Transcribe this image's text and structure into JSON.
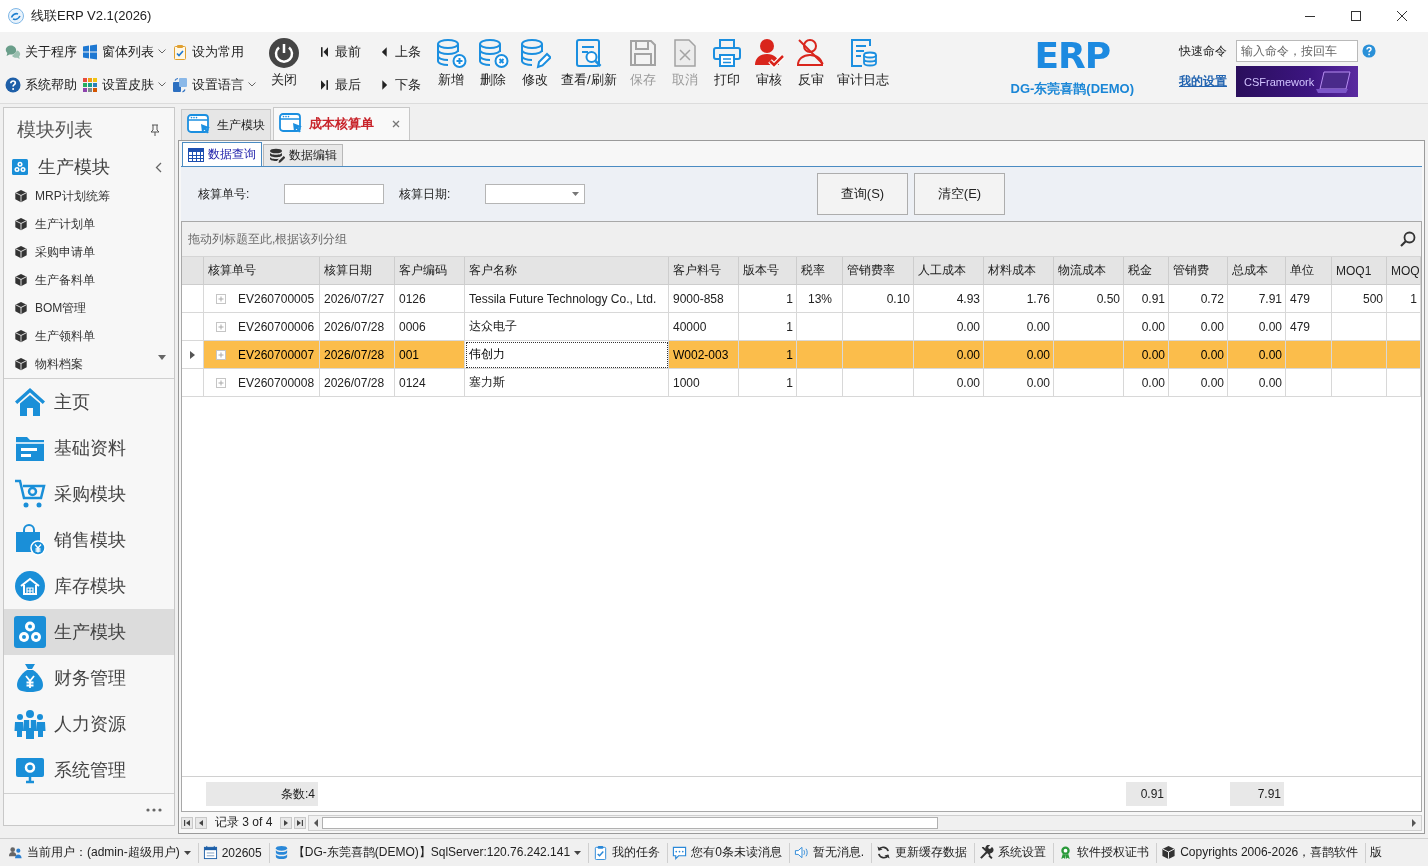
{
  "window": {
    "title": "线联ERP V2.1(2026)"
  },
  "toolbar": {
    "quick_items": [
      {
        "label": "关于程序",
        "dropdown": false
      },
      {
        "label": "窗体列表",
        "dropdown": true
      },
      {
        "label": "设为常用",
        "dropdown": false
      },
      {
        "label": "系统帮助",
        "dropdown": false
      },
      {
        "label": "设置皮肤",
        "dropdown": true
      },
      {
        "label": "设置语言",
        "dropdown": true
      }
    ],
    "close_button": {
      "label": "关闭"
    },
    "nav_buttons": [
      {
        "label": "最前"
      },
      {
        "label": "上条"
      },
      {
        "label": "最后"
      },
      {
        "label": "下条"
      }
    ],
    "buttons": [
      {
        "label": "新增",
        "disabled": false
      },
      {
        "label": "删除",
        "disabled": false
      },
      {
        "label": "修改",
        "disabled": false
      },
      {
        "label": "查看/刷新",
        "disabled": false
      },
      {
        "label": "保存",
        "disabled": true
      },
      {
        "label": "取消",
        "disabled": true
      },
      {
        "label": "打印",
        "disabled": false
      },
      {
        "label": "审核",
        "disabled": false
      },
      {
        "label": "反审",
        "disabled": false
      },
      {
        "label": "审计日志",
        "disabled": false
      }
    ],
    "brand": {
      "logo": "ERP",
      "company": "DG-东莞喜鹊(DEMO)"
    },
    "quick_command": {
      "label": "快速命令",
      "placeholder": "输入命令，按回车"
    },
    "settings_link": "我的设置",
    "banner": {
      "text": "CSFramework"
    }
  },
  "sidebar": {
    "title": "模块列表",
    "group": {
      "label": "生产模块"
    },
    "items": [
      "MRP计划统筹",
      "生产计划单",
      "采购申请单",
      "生产备料单",
      "BOM管理",
      "生产领料单",
      "物料档案"
    ],
    "modules": [
      {
        "label": "主页",
        "selected": false
      },
      {
        "label": "基础资料",
        "selected": false
      },
      {
        "label": "采购模块",
        "selected": false
      },
      {
        "label": "销售模块",
        "selected": false
      },
      {
        "label": "库存模块",
        "selected": false
      },
      {
        "label": "生产模块",
        "selected": true
      },
      {
        "label": "财务管理",
        "selected": false
      },
      {
        "label": "人力资源",
        "selected": false
      },
      {
        "label": "系统管理",
        "selected": false
      }
    ]
  },
  "tabs": [
    {
      "label": "生产模块",
      "selected": false,
      "closable": false
    },
    {
      "label": "成本核算单",
      "selected": true,
      "closable": true
    }
  ],
  "view_tabs": [
    {
      "label": "数据查询",
      "selected": true
    },
    {
      "label": "数据编辑",
      "selected": false
    }
  ],
  "query": {
    "fields": [
      {
        "label": "核算单号:",
        "kind": "text"
      },
      {
        "label": "核算日期:",
        "kind": "date"
      }
    ],
    "buttons": [
      "查询(S)",
      "清空(E)"
    ]
  },
  "grid": {
    "group_hint": "拖动列标题至此,根据该列分组",
    "columns": [
      {
        "label": "核算单号",
        "kind": "text"
      },
      {
        "label": "核算日期",
        "kind": "text"
      },
      {
        "label": "客户编码",
        "kind": "text"
      },
      {
        "label": "客户名称",
        "kind": "text"
      },
      {
        "label": "客户料号",
        "kind": "text"
      },
      {
        "label": "版本号",
        "kind": "number"
      },
      {
        "label": "税率",
        "kind": "percent"
      },
      {
        "label": "管销费率",
        "kind": "number"
      },
      {
        "label": "人工成本",
        "kind": "number"
      },
      {
        "label": "材料成本",
        "kind": "number"
      },
      {
        "label": "物流成本",
        "kind": "number"
      },
      {
        "label": "税金",
        "kind": "number"
      },
      {
        "label": "管销费",
        "kind": "number"
      },
      {
        "label": "总成本",
        "kind": "number"
      },
      {
        "label": "单位",
        "kind": "text"
      },
      {
        "label": "MOQ1",
        "kind": "number"
      },
      {
        "label": "MOQ",
        "kind": "number"
      }
    ],
    "rows": [
      {
        "selected": false,
        "order_no": "EV260700005",
        "date": "2026/07/27",
        "customer_code": "0126",
        "customer_name": "Tessila Future Technology Co., Ltd.",
        "part_no": "9000-858",
        "version": "1",
        "tax_rate": "13%",
        "fee_rate": "0.10",
        "labor_cost": "4.93",
        "material_cost": "1.76",
        "logistics_cost": "0.50",
        "tax": "0.91",
        "fee": "0.72",
        "total_cost": "7.91",
        "unit": "479",
        "moq1": "500",
        "column_17": "1"
      },
      {
        "selected": false,
        "order_no": "EV260700006",
        "date": "2026/07/28",
        "customer_code": "0006",
        "customer_name": "达众电子",
        "part_no": "40000",
        "version": "1",
        "labor_cost": "0.00",
        "material_cost": "0.00",
        "tax": "0.00",
        "fee": "0.00",
        "total_cost": "0.00",
        "unit": "479"
      },
      {
        "selected": true,
        "order_no": "EV260700007",
        "date": "2026/07/28",
        "customer_code": "001",
        "customer_name": {
          "text": "伟创力",
          "focused": true
        },
        "part_no": "W002-003",
        "version": "1",
        "labor_cost": "0.00",
        "material_cost": "0.00",
        "tax": "0.00",
        "fee": "0.00",
        "total_cost": "0.00"
      },
      {
        "selected": false,
        "order_no": "EV260700008",
        "date": "2026/07/28",
        "customer_code": "0124",
        "customer_name": "塞力斯",
        "part_no": "1000",
        "version": "1",
        "labor_cost": "0.00",
        "material_cost": "0.00",
        "tax": "0.00",
        "fee": "0.00",
        "total_cost": "0.00"
      }
    ],
    "summary": {
      "order_no": "条数:4",
      "tax": "0.91",
      "total_cost": "7.91"
    },
    "navigator": "记录 3 of 4"
  },
  "status_bar": {
    "items": [
      {
        "label": "当前用户：(admin-超级用户)",
        "dropdown": true
      },
      {
        "label": "202605",
        "dropdown": false
      },
      {
        "label": "【DG-东莞喜鹊(DEMO)】SqlServer:120.76.242.141",
        "dropdown": true
      },
      {
        "label": "我的任务",
        "dropdown": false
      },
      {
        "label": "您有0条未读消息",
        "dropdown": false
      },
      {
        "label": "暂无消息.",
        "dropdown": false
      },
      {
        "label": "更新缓存数据",
        "dropdown": false
      },
      {
        "label": "系统设置",
        "dropdown": false
      },
      {
        "label": "软件授权证书",
        "dropdown": false
      },
      {
        "label": "Copyrights 2006-2026，喜鹊软件",
        "dropdown": false
      },
      {
        "label": "版",
        "dropdown": false
      }
    ]
  }
}
